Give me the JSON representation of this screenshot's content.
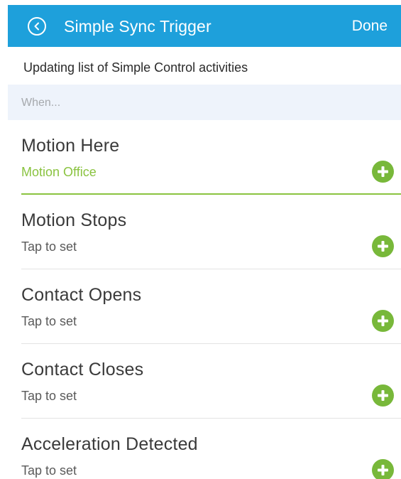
{
  "header": {
    "back_icon": "circle-chevron-left-icon",
    "title": "Simple Sync Trigger",
    "done_label": "Done"
  },
  "status": {
    "text": "Updating list of Simple Control activities"
  },
  "section": {
    "label": "When..."
  },
  "triggers": [
    {
      "title": "Motion Here",
      "subtitle": "Motion Office",
      "selected": true,
      "action_icon": "plus-circle-icon"
    },
    {
      "title": "Motion Stops",
      "subtitle": "Tap to set",
      "selected": false,
      "action_icon": "plus-circle-icon"
    },
    {
      "title": "Contact Opens",
      "subtitle": "Tap to set",
      "selected": false,
      "action_icon": "plus-circle-icon"
    },
    {
      "title": "Contact Closes",
      "subtitle": "Tap to set",
      "selected": false,
      "action_icon": "plus-circle-icon"
    },
    {
      "title": "Acceleration Detected",
      "subtitle": "Tap to set",
      "selected": false,
      "action_icon": "plus-circle-icon"
    }
  ],
  "colors": {
    "header": "#1ea0db",
    "accent_green": "#8ac340",
    "add_button": "#78b83a",
    "section_bg": "#eef3fb"
  }
}
